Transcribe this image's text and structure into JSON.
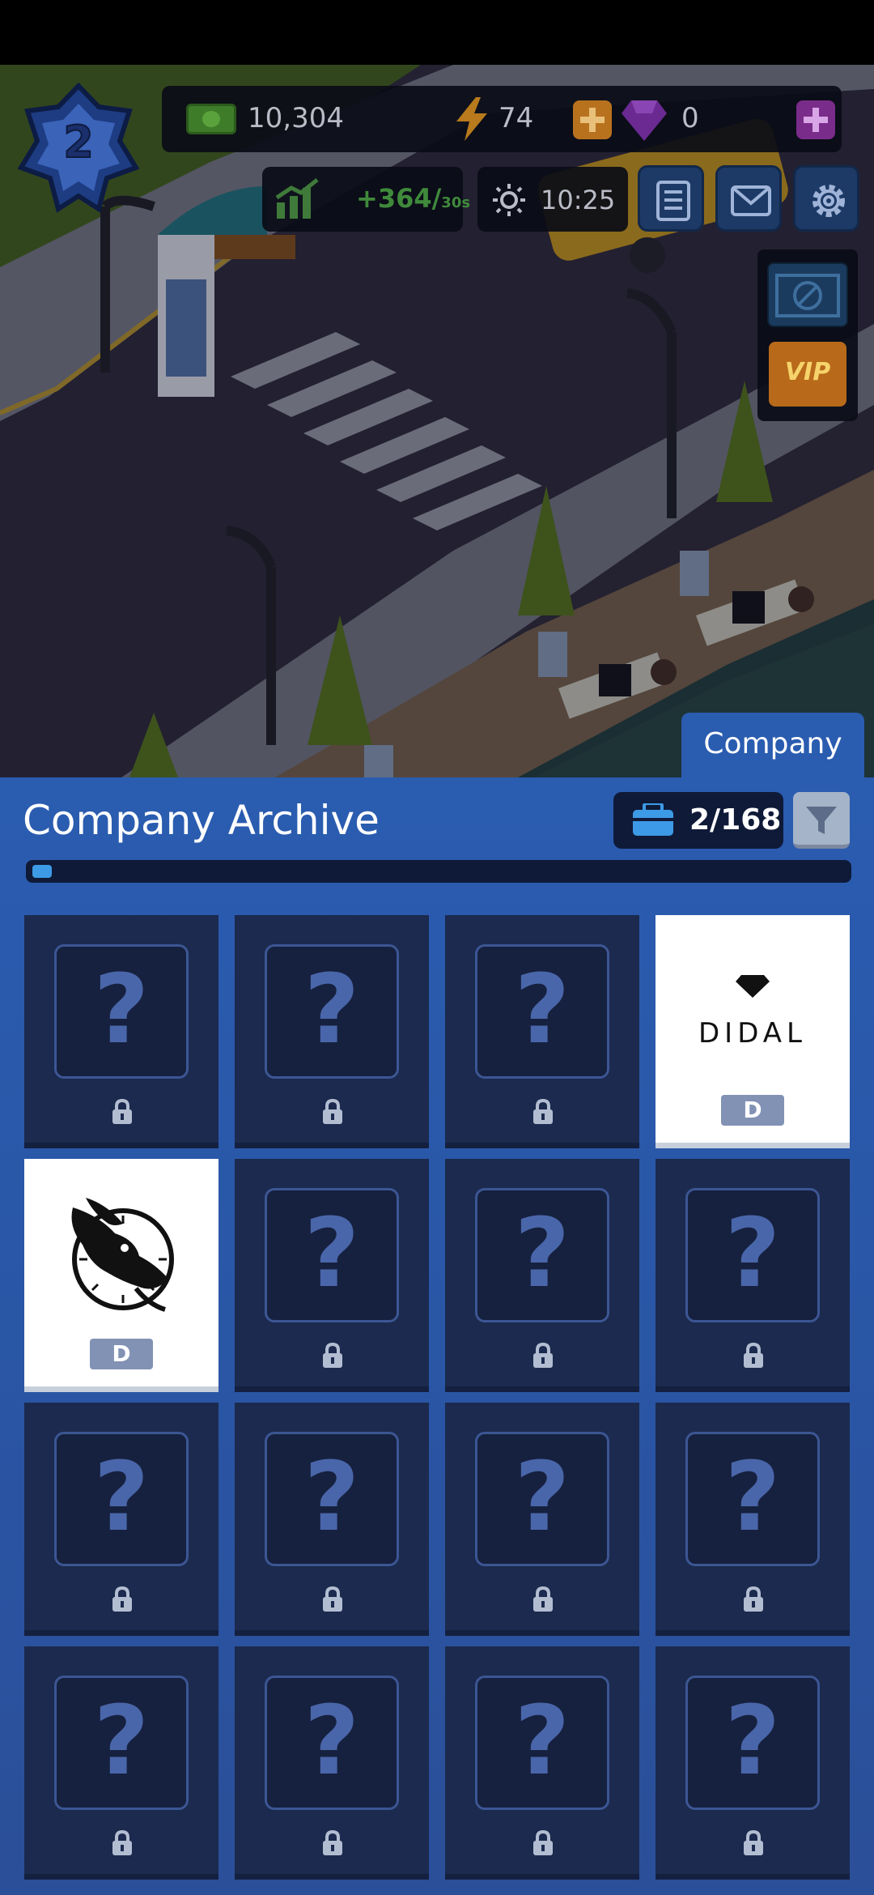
{
  "hud": {
    "level": "2",
    "cash": "10,304",
    "energy": "74",
    "gems": "0",
    "income": "+364/",
    "income_unit": "30s",
    "clock": "10:25",
    "vip_label": "VIP"
  },
  "tabs": {
    "company_label": "Company"
  },
  "archive": {
    "title": "Company Archive",
    "count": "2/168",
    "progress_fraction": 0.012,
    "cards": [
      {
        "state": "locked"
      },
      {
        "state": "locked"
      },
      {
        "state": "locked"
      },
      {
        "state": "unlocked",
        "logo": "didal",
        "name": "DIDAL",
        "grade": "D"
      },
      {
        "state": "unlocked",
        "logo": "rabbit",
        "grade": "D"
      },
      {
        "state": "locked"
      },
      {
        "state": "locked"
      },
      {
        "state": "locked"
      },
      {
        "state": "locked"
      },
      {
        "state": "locked"
      },
      {
        "state": "locked"
      },
      {
        "state": "locked"
      },
      {
        "state": "locked"
      },
      {
        "state": "locked"
      },
      {
        "state": "locked"
      },
      {
        "state": "locked"
      }
    ],
    "locked_symbol": "?"
  },
  "colors": {
    "panel_blue": "#2a5cb0",
    "card_locked": "#1b2a4e",
    "income_green": "#3f8a3b",
    "progress_blue": "#3d9ae6"
  }
}
